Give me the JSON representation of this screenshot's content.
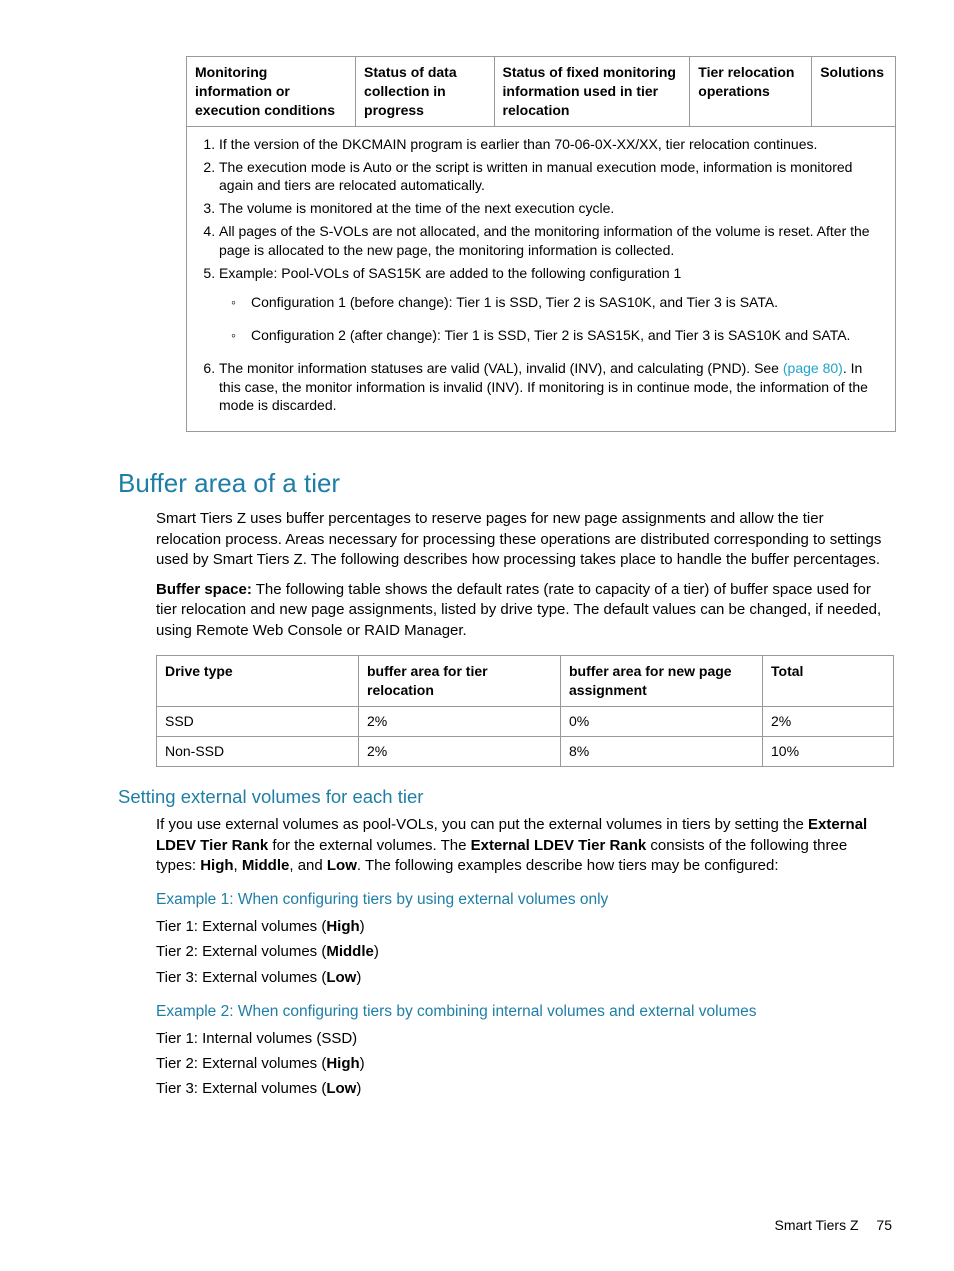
{
  "table1": {
    "headers": {
      "c1": "Monitoring information or execution conditions",
      "c2": "Status of data collection in progress",
      "c3": "Status of fixed monitoring information used in tier relocation",
      "c4": "Tier relocation operations",
      "c5": "Solutions"
    },
    "notes": {
      "n1": "If the version of the DKCMAIN program is earlier than 70-06-0X-XX/XX, tier relocation continues.",
      "n2": "The execution mode is Auto or the script is written in manual execution mode, information is monitored again and tiers are relocated automatically.",
      "n3": "The volume is monitored at the time of the next execution cycle.",
      "n4": "All pages of the S-VOLs are not allocated, and the monitoring information of the volume is reset. After the page is allocated to the new page, the monitoring information is collected.",
      "n5": "Example: Pool-VOLs of SAS15K are added to the following configuration 1",
      "n5a": "Configuration 1 (before change): Tier 1 is SSD, Tier 2 is SAS10K, and Tier 3 is SATA.",
      "n5b": "Configuration 2 (after change): Tier 1 is SSD, Tier 2 is SAS15K, and Tier 3 is SAS10K and SATA.",
      "n6_pre": "The monitor information statuses are valid (VAL), invalid (INV), and calculating (PND). See ",
      "n6_link": "(page 80)",
      "n6_post": ". In this case, the monitor information is invalid (INV). If monitoring is in continue mode, the information of the mode is discarded."
    }
  },
  "section1": {
    "heading": "Buffer area of a tier",
    "p1": "Smart Tiers Z uses buffer percentages to reserve pages for new page assignments and allow the tier relocation process. Areas necessary for processing these operations are distributed corresponding to settings used by Smart Tiers Z. The following describes how processing takes place to handle the buffer percentages.",
    "p2_label": "Buffer space:",
    "p2_rest": " The following table shows the default rates (rate to capacity of a tier) of buffer space used for tier relocation and new page assignments, listed by drive type. The default values can be changed, if needed, using Remote Web Console or RAID Manager."
  },
  "table2": {
    "headers": {
      "c1": "Drive type",
      "c2": "buffer area for tier relocation",
      "c3": "buffer area for new page assignment",
      "c4": "Total"
    },
    "rows": [
      {
        "c1": "SSD",
        "c2": "2%",
        "c3": "0%",
        "c4": "2%"
      },
      {
        "c1": "Non-SSD",
        "c2": "2%",
        "c3": "8%",
        "c4": "10%"
      }
    ]
  },
  "section2": {
    "heading": "Setting external volumes for each tier",
    "p1_a": "If you use external volumes as pool-VOLs, you can put the external volumes in tiers by setting the ",
    "p1_b1": "External LDEV Tier Rank",
    "p1_c": " for the external volumes. The ",
    "p1_b2": "External LDEV Tier Rank",
    "p1_d": " consists of the following three types: ",
    "p1_high": "High",
    "p1_sep1": ", ",
    "p1_mid": "Middle",
    "p1_sep2": ", and ",
    "p1_low": "Low",
    "p1_e": ". The following examples describe how tiers may be configured:"
  },
  "ex1": {
    "heading": "Example 1: When configuring tiers by using external volumes only",
    "t1_pre": "Tier 1: External volumes (",
    "t1_b": "High",
    "t1_post": ")",
    "t2_pre": "Tier 2: External volumes (",
    "t2_b": "Middle",
    "t2_post": ")",
    "t3_pre": "Tier 3: External volumes (",
    "t3_b": "Low",
    "t3_post": ")"
  },
  "ex2": {
    "heading": "Example 2: When configuring tiers by combining internal volumes and external volumes",
    "t1": "Tier 1: Internal volumes (SSD)",
    "t2_pre": "Tier 2: External volumes (",
    "t2_b": "High",
    "t2_post": ")",
    "t3_pre": "Tier 3: External volumes (",
    "t3_b": "Low",
    "t3_post": ")"
  },
  "footer": {
    "title": "Smart Tiers Z",
    "page": "75"
  }
}
